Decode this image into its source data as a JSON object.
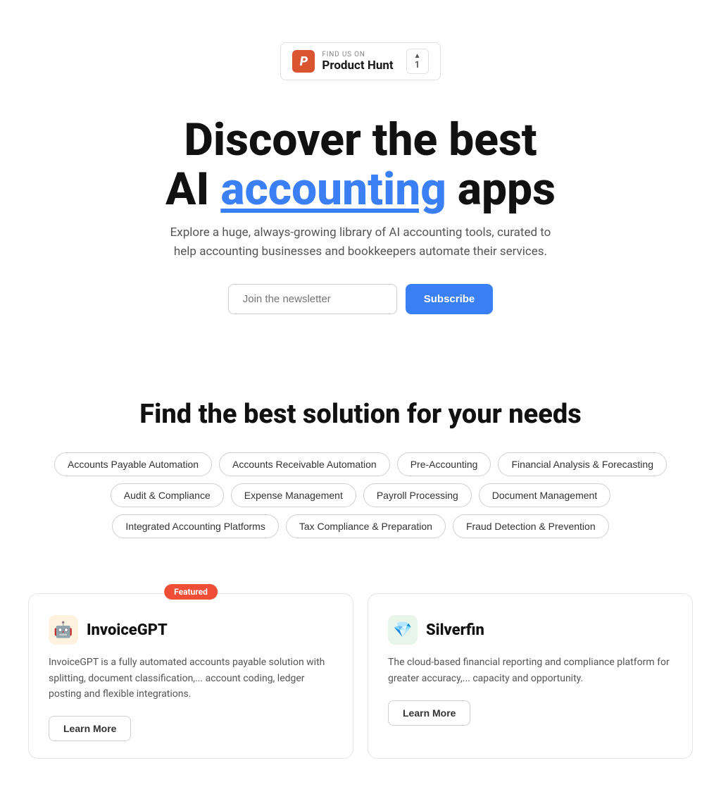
{
  "producthunt": {
    "find_us_label": "FIND US ON",
    "name": "Product Hunt",
    "vote_count": "1",
    "arrow": "▲"
  },
  "hero": {
    "line1": "Discover the best",
    "line2_prefix": "AI ",
    "line2_accent": "accounting",
    "line2_suffix": " apps",
    "subtitle": "Explore a huge, always-growing library of AI accounting tools, curated to help accounting businesses and bookkeepers automate their services."
  },
  "subscribe": {
    "placeholder": "Join the newsletter",
    "button_label": "Subscribe"
  },
  "solutions": {
    "title": "Find the best solution for your needs",
    "tags": [
      "Accounts Payable Automation",
      "Accounts Receivable Automation",
      "Pre-Accounting",
      "Financial Analysis & Forecasting",
      "Audit & Compliance",
      "Expense Management",
      "Payroll Processing",
      "Document Management",
      "Integrated Accounting Platforms",
      "Tax Compliance & Preparation",
      "Fraud Detection & Prevention"
    ]
  },
  "cards": [
    {
      "featured": true,
      "featured_label": "Featured",
      "logo_emoji": "🤖",
      "name": "InvoiceGPT",
      "description": "InvoiceGPT is a fully automated accounts payable solution with splitting, document classification,... account coding, ledger posting and flexible integrations.",
      "cta": "Learn More"
    },
    {
      "featured": false,
      "featured_label": "",
      "logo_emoji": "💎",
      "name": "Silverfin",
      "description": "The cloud-based financial reporting and compliance platform for greater accuracy,... capacity and opportunity.",
      "cta": "Learn More"
    }
  ]
}
